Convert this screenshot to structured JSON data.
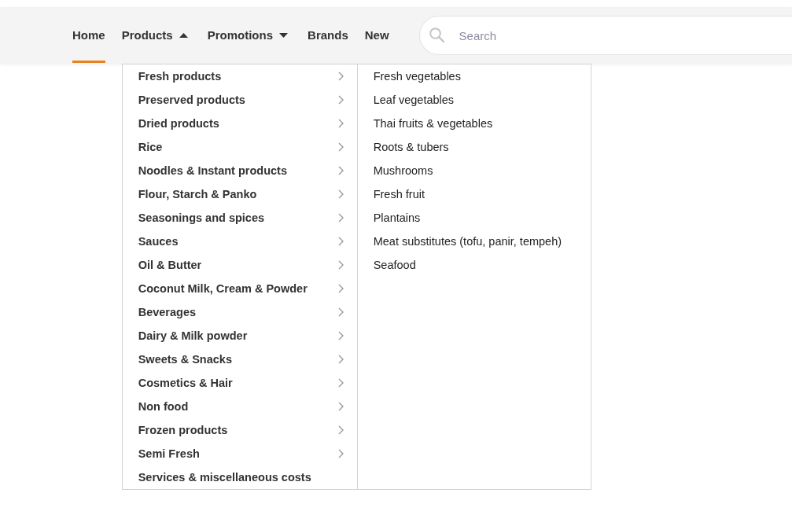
{
  "nav": {
    "items": [
      {
        "label": "Home",
        "kind": "link",
        "selected": true
      },
      {
        "label": "Products",
        "kind": "dropdown",
        "selected": false,
        "expanded": true,
        "menu": {
          "items": [
            {
              "label": "Fresh products",
              "has_submenu": true,
              "children": [
                {
                  "label": "Fresh vegetables"
                },
                {
                  "label": "Leaf vegetables"
                },
                {
                  "label": "Thai fruits & vegetables"
                },
                {
                  "label": "Roots & tubers"
                },
                {
                  "label": "Mushrooms"
                },
                {
                  "label": "Fresh fruit"
                },
                {
                  "label": "Plantains"
                },
                {
                  "label": "Meat substitutes (tofu, panir, tempeh)"
                },
                {
                  "label": "Seafood"
                }
              ]
            },
            {
              "label": "Preserved products",
              "has_submenu": true
            },
            {
              "label": "Dried products",
              "has_submenu": true
            },
            {
              "label": "Rice",
              "has_submenu": true
            },
            {
              "label": "Noodles & Instant products",
              "has_submenu": true
            },
            {
              "label": "Flour, Starch & Panko",
              "has_submenu": true
            },
            {
              "label": "Seasonings and spices",
              "has_submenu": true
            },
            {
              "label": "Sauces",
              "has_submenu": true
            },
            {
              "label": "Oil & Butter",
              "has_submenu": true
            },
            {
              "label": "Coconut Milk, Cream & Powder",
              "has_submenu": true
            },
            {
              "label": "Beverages",
              "has_submenu": true
            },
            {
              "label": "Dairy & Milk powder",
              "has_submenu": true
            },
            {
              "label": "Sweets & Snacks",
              "has_submenu": true
            },
            {
              "label": "Cosmetics & Hair",
              "has_submenu": true
            },
            {
              "label": "Non food",
              "has_submenu": true
            },
            {
              "label": "Frozen products",
              "has_submenu": true
            },
            {
              "label": "Semi Fresh",
              "has_submenu": true
            },
            {
              "label": "Services & miscellaneous costs",
              "has_submenu": false
            }
          ]
        }
      },
      {
        "label": "Promotions",
        "kind": "dropdown",
        "selected": false,
        "expanded": false
      },
      {
        "label": "Brands",
        "kind": "link",
        "selected": false
      },
      {
        "label": "New",
        "kind": "link",
        "selected": false
      }
    ]
  },
  "search": {
    "placeholder": "Search"
  }
}
